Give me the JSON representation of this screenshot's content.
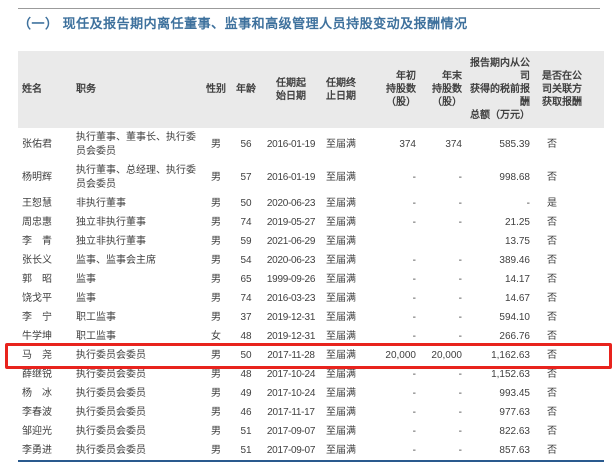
{
  "page": {
    "title": "（一） 现任及报告期内离任董事、监事和高级管理人员持股变动及报酬情况"
  },
  "colors": {
    "title_blue": "#3e719d",
    "header_bg": "#eaeaea",
    "table_bottom_border_blue": "#2a5a8e",
    "highlight_red": "#e8231d"
  },
  "table": {
    "columns": [
      {
        "label": "姓名"
      },
      {
        "label": "职务"
      },
      {
        "label": "性别"
      },
      {
        "label": "年龄"
      },
      {
        "label": "任期起\n始日期"
      },
      {
        "label": "任期终\n止日期"
      },
      {
        "label": "年初\n持股数\n（股）"
      },
      {
        "label": "年末\n持股数\n（股）"
      },
      {
        "label": "报告期内从公司\n获得的税前报酬\n总额（万元）"
      },
      {
        "label": "是否在公\n司关联方\n获取报酬"
      }
    ],
    "rows": [
      {
        "highlighted": false,
        "cells": [
          "张佑君",
          "执行董事、董事长、执行委员会委员",
          "男",
          "56",
          "2016-01-19",
          "至届满",
          "374",
          "374",
          "585.39",
          "否"
        ]
      },
      {
        "highlighted": false,
        "cells": [
          "杨明辉",
          "执行董事、总经理、执行委员会委员",
          "男",
          "57",
          "2016-01-19",
          "至届满",
          "-",
          "-",
          "998.68",
          "否"
        ]
      },
      {
        "highlighted": false,
        "cells": [
          "王恕慧",
          "非执行董事",
          "男",
          "50",
          "2020-06-23",
          "至届满",
          "-",
          "-",
          "-",
          "是"
        ]
      },
      {
        "highlighted": false,
        "cells": [
          "周忠惠",
          "独立非执行董事",
          "男",
          "74",
          "2019-05-27",
          "至届满",
          "-",
          "-",
          "21.25",
          "否"
        ]
      },
      {
        "highlighted": false,
        "cells": [
          "李　青",
          "独立非执行董事",
          "男",
          "59",
          "2021-06-29",
          "至届满",
          "",
          "",
          "13.75",
          "否"
        ]
      },
      {
        "highlighted": false,
        "cells": [
          "张长义",
          "监事、监事会主席",
          "男",
          "54",
          "2020-06-23",
          "至届满",
          "-",
          "-",
          "389.46",
          "否"
        ]
      },
      {
        "highlighted": false,
        "cells": [
          "郭　昭",
          "监事",
          "男",
          "65",
          "1999-09-26",
          "至届满",
          "-",
          "-",
          "14.17",
          "否"
        ]
      },
      {
        "highlighted": false,
        "cells": [
          "饶戈平",
          "监事",
          "男",
          "74",
          "2016-03-23",
          "至届满",
          "-",
          "-",
          "14.67",
          "否"
        ]
      },
      {
        "highlighted": false,
        "cells": [
          "李　宁",
          "职工监事",
          "男",
          "37",
          "2019-12-31",
          "至届满",
          "-",
          "-",
          "594.10",
          "否"
        ]
      },
      {
        "highlighted": false,
        "cells": [
          "牛学坤",
          "职工监事",
          "女",
          "48",
          "2019-12-31",
          "至届满",
          "-",
          "-",
          "266.76",
          "否"
        ]
      },
      {
        "highlighted": true,
        "cells": [
          "马　尧",
          "执行委员会委员",
          "男",
          "50",
          "2017-11-28",
          "至届满",
          "20,000",
          "20,000",
          "1,162.63",
          "否"
        ]
      },
      {
        "highlighted": false,
        "cells": [
          "薛继锐",
          "执行委员会委员",
          "男",
          "48",
          "2017-10-24",
          "至届满",
          "-",
          "-",
          "1,152.63",
          "否"
        ]
      },
      {
        "highlighted": false,
        "cells": [
          "杨　冰",
          "执行委员会委员",
          "男",
          "49",
          "2017-10-24",
          "至届满",
          "-",
          "-",
          "993.45",
          "否"
        ]
      },
      {
        "highlighted": false,
        "cells": [
          "李春波",
          "执行委员会委员",
          "男",
          "46",
          "2017-11-17",
          "至届满",
          "-",
          "-",
          "977.63",
          "否"
        ]
      },
      {
        "highlighted": false,
        "cells": [
          "邹迎光",
          "执行委员会委员",
          "男",
          "51",
          "2017-09-07",
          "至届满",
          "-",
          "-",
          "822.63",
          "否"
        ]
      },
      {
        "highlighted": false,
        "cells": [
          "李勇进",
          "执行委员会委员",
          "男",
          "51",
          "2017-09-07",
          "至届满",
          "-",
          "-",
          "857.63",
          "否"
        ]
      }
    ]
  }
}
